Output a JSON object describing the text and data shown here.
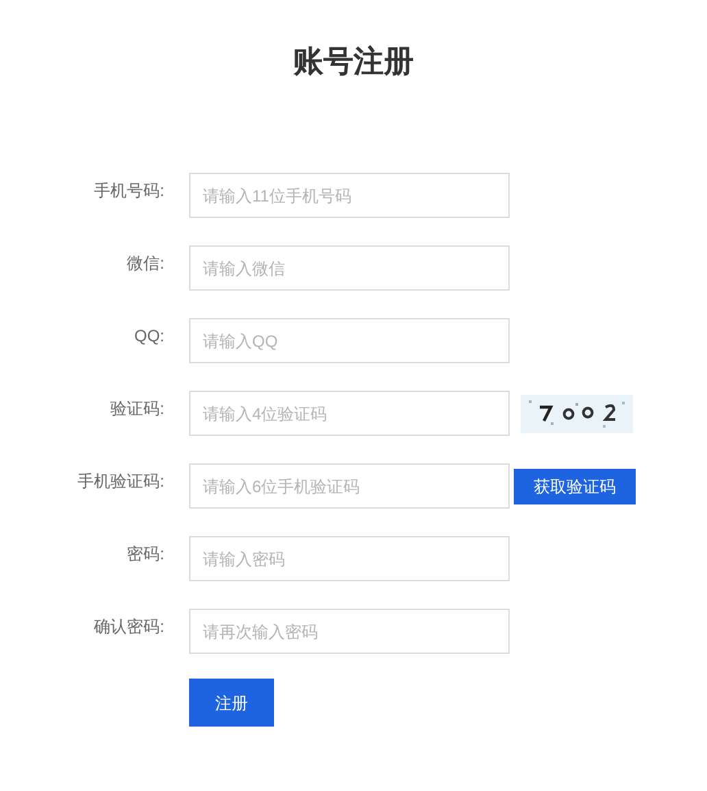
{
  "title": "账号注册",
  "fields": [
    {
      "label": "手机号码:",
      "placeholder": "请输入11位手机号码",
      "kind": "text"
    },
    {
      "label": "微信:",
      "placeholder": "请输入微信",
      "kind": "text"
    },
    {
      "label": "QQ:",
      "placeholder": "请输入QQ",
      "kind": "text"
    },
    {
      "label": "验证码:",
      "placeholder": "请输入4位验证码",
      "kind": "captcha"
    },
    {
      "label": "手机验证码:",
      "placeholder": "请输入6位手机验证码",
      "kind": "sms",
      "button": "获取验证码"
    },
    {
      "label": "密码:",
      "placeholder": "请输入密码",
      "kind": "password"
    },
    {
      "label": "确认密码:",
      "placeholder": "请再次输入密码",
      "kind": "password"
    }
  ],
  "submit": "注册"
}
